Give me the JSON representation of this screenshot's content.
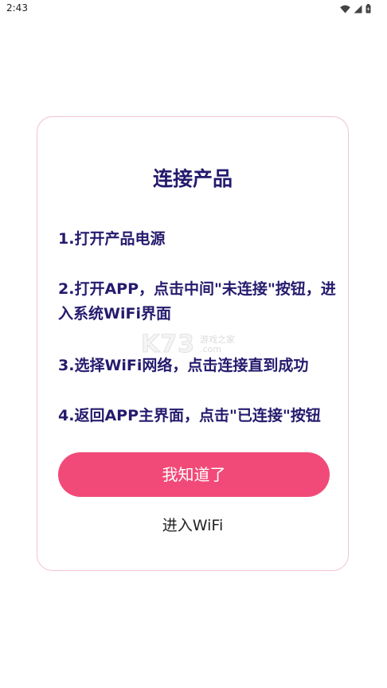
{
  "status_bar": {
    "time": "2:43",
    "icons": [
      "wifi-icon",
      "signal-icon",
      "battery-icon"
    ]
  },
  "dialog": {
    "title": "连接产品",
    "steps": [
      "1.打开产品电源",
      "2.打开APP，点击中间\"未连接\"按钮，进入系统WiFi界面",
      "3.选择WiFi网络，点击连接直到成功",
      "4.返回APP主界面，点击\"已连接\"按钮"
    ],
    "primary_button": "我知道了",
    "secondary_link": "进入WiFi"
  },
  "watermark": {
    "logo": "K73",
    "line1": "游戏之家",
    "line2": ".com"
  },
  "colors": {
    "title": "#241b6e",
    "button": "#f14a78",
    "card_border": "#f2c4d0"
  }
}
